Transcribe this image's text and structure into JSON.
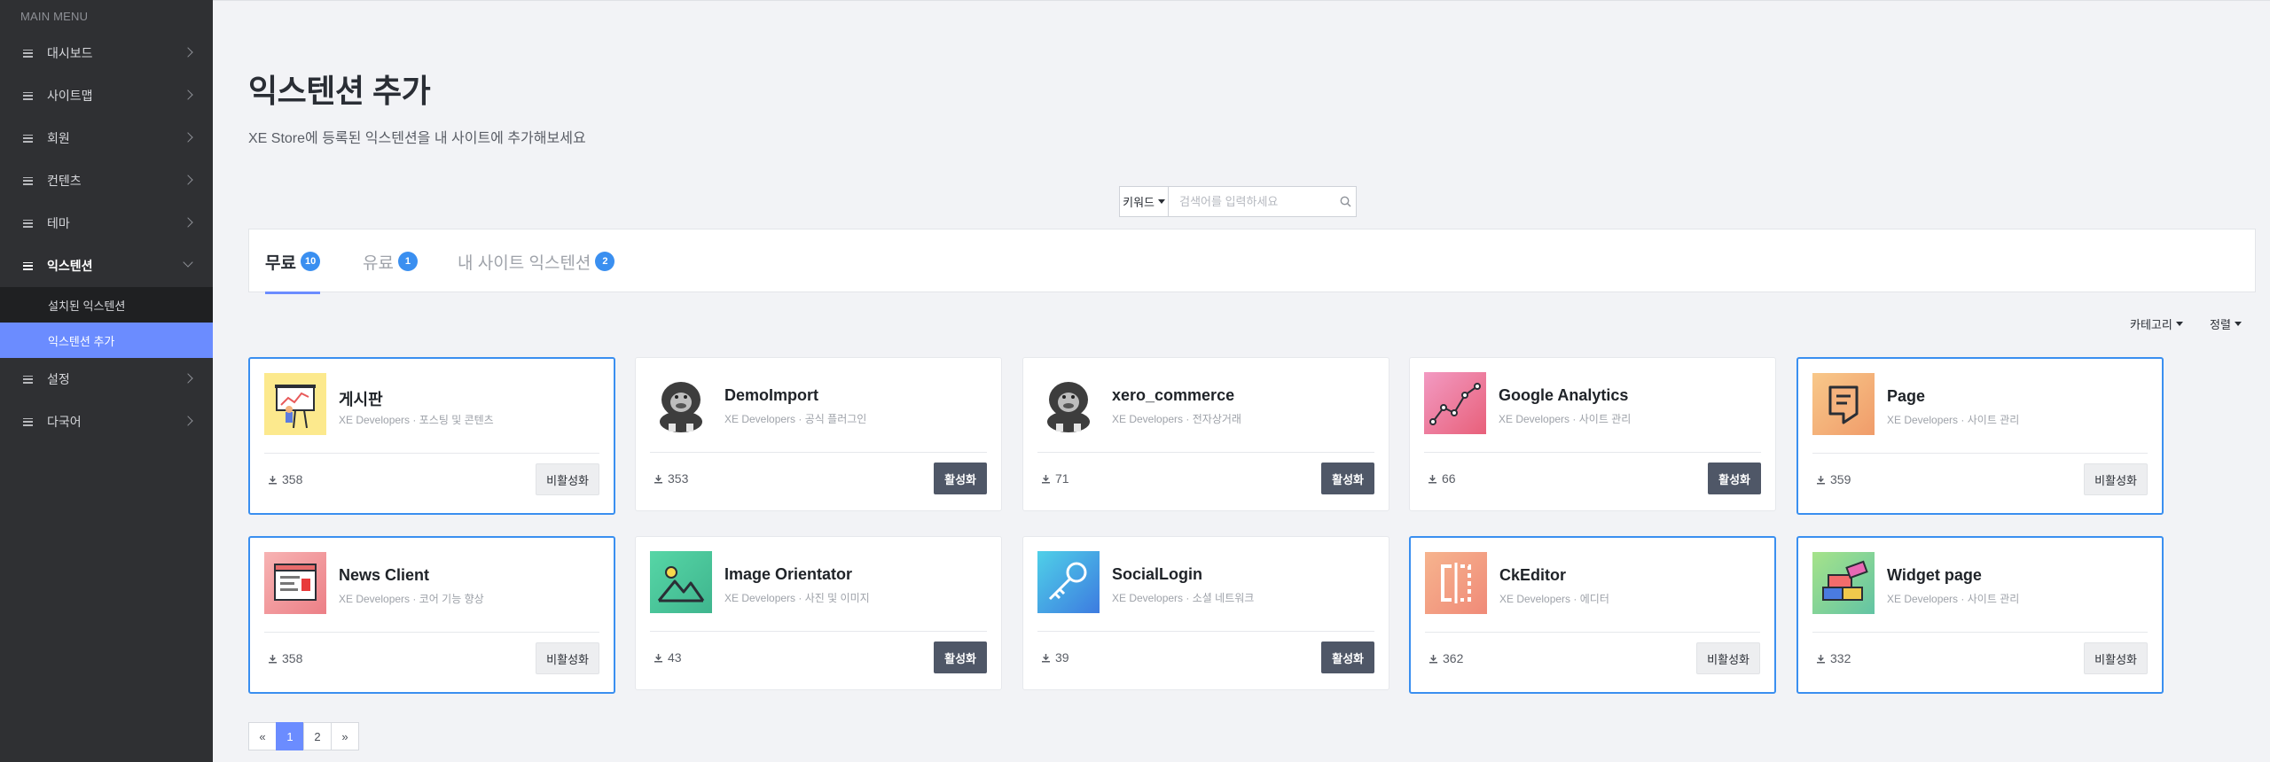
{
  "sidebar": {
    "title": "MAIN MENU",
    "items": [
      {
        "label": "대시보드"
      },
      {
        "label": "사이트맵"
      },
      {
        "label": "회원"
      },
      {
        "label": "컨텐츠"
      },
      {
        "label": "테마"
      },
      {
        "label": "익스텐션"
      },
      {
        "label": "설정"
      },
      {
        "label": "다국어"
      }
    ],
    "submenu": [
      {
        "label": "설치된 익스텐션"
      },
      {
        "label": "익스텐션 추가"
      }
    ]
  },
  "page": {
    "title": "익스텐션 추가",
    "subtitle": "XE Store에 등록된 익스텐션을 내 사이트에 추가해보세요"
  },
  "search": {
    "keyword_label": "키워드",
    "placeholder": "검색어를 입력하세요"
  },
  "tabs": [
    {
      "label": "무료",
      "count": "10"
    },
    {
      "label": "유료",
      "count": "1"
    },
    {
      "label": "내 사이트 익스텐션",
      "count": "2"
    }
  ],
  "filters": {
    "category": "카테고리",
    "sort": "정렬"
  },
  "cards": [
    {
      "name": "게시판",
      "author": "XE Developers",
      "category": "포스팅 및 콘텐츠",
      "downloads": "358",
      "button": "비활성화",
      "icon": "presentation-board-icon"
    },
    {
      "name": "DemoImport",
      "author": "XE Developers",
      "category": "공식 플러그인",
      "downloads": "353",
      "button": "활성화",
      "icon": "gorilla-icon"
    },
    {
      "name": "xero_commerce",
      "author": "XE Developers",
      "category": "전자상거래",
      "downloads": "71",
      "button": "활성화",
      "icon": "gorilla-icon"
    },
    {
      "name": "Google Analytics",
      "author": "XE Developers",
      "category": "사이트 관리",
      "downloads": "66",
      "button": "활성화",
      "icon": "analytics-chart-icon"
    },
    {
      "name": "Page",
      "author": "XE Developers",
      "category": "사이트 관리",
      "downloads": "359",
      "button": "비활성화",
      "icon": "page-icon"
    },
    {
      "name": "News Client",
      "author": "XE Developers",
      "category": "코어 기능 향상",
      "downloads": "358",
      "button": "비활성화",
      "icon": "news-browser-icon"
    },
    {
      "name": "Image Orientator",
      "author": "XE Developers",
      "category": "사진 및 이미지",
      "downloads": "43",
      "button": "활성화",
      "icon": "image-mountain-icon"
    },
    {
      "name": "SocialLogin",
      "author": "XE Developers",
      "category": "소셜 네트워크",
      "downloads": "39",
      "button": "활성화",
      "icon": "key-icon"
    },
    {
      "name": "CkEditor",
      "author": "XE Developers",
      "category": "에디터",
      "downloads": "362",
      "button": "비활성화",
      "icon": "editor-brackets-icon"
    },
    {
      "name": "Widget page",
      "author": "XE Developers",
      "category": "사이트 관리",
      "downloads": "332",
      "button": "비활성화",
      "icon": "lego-bricks-icon"
    }
  ],
  "meta_separator": "·",
  "pagination": {
    "prev": "«",
    "pages": [
      "1",
      "2"
    ],
    "next": "»"
  },
  "colors": {
    "accent": "#6b8cff",
    "badge": "#3a8ff0",
    "active_button": "#4f5767",
    "sidebar_bg": "#2f3033"
  }
}
